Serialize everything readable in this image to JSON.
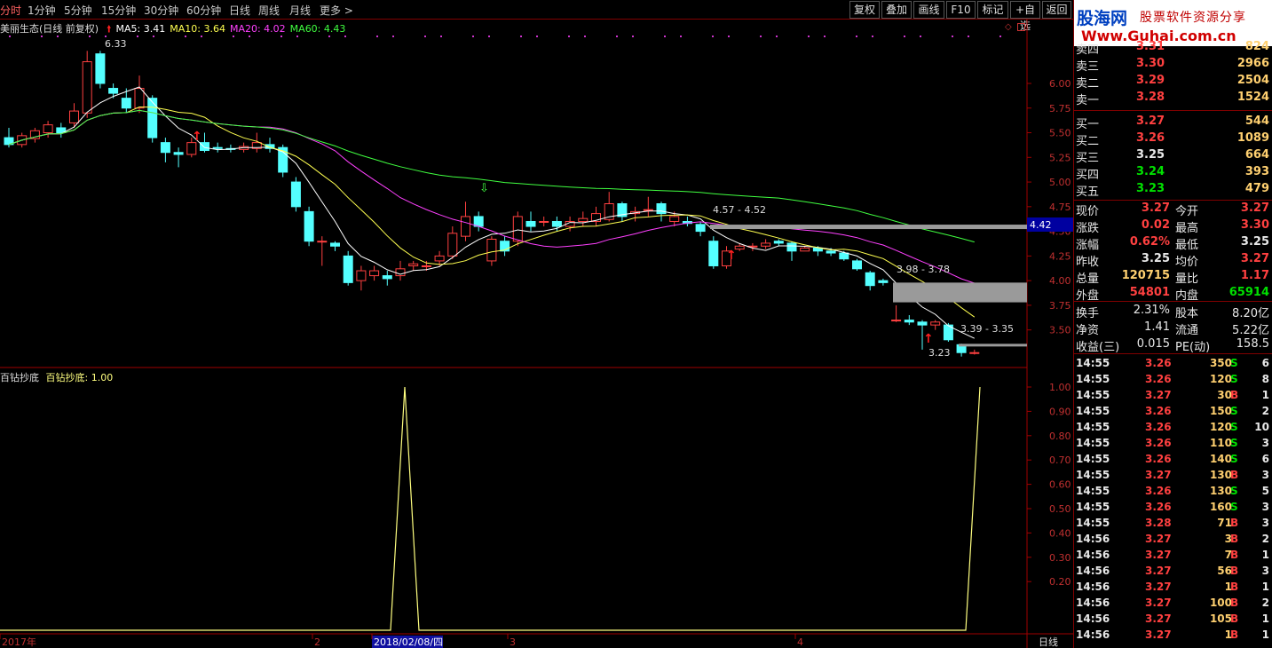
{
  "toolbar": {
    "timeframes": [
      "分时",
      "1分钟",
      "5分钟",
      "15分钟",
      "30分钟",
      "60分钟",
      "日线",
      "周线",
      "月线",
      "更多 >"
    ],
    "buttons": [
      "复权",
      "叠加",
      "画线",
      "F10",
      "标记",
      "+自选",
      "返回"
    ]
  },
  "main_chart": {
    "stock_title": "美丽生态(日线 前复权)",
    "ma_legend": [
      {
        "label": "MA5: 3.41",
        "color": "#ffffff"
      },
      {
        "label": "MA10: 3.64",
        "color": "#ffff50"
      },
      {
        "label": "MA20: 4.02",
        "color": "#ff40ff"
      },
      {
        "label": "MA60: 4.43",
        "color": "#40ff40"
      }
    ],
    "y_ticks": [
      "6.00",
      "5.75",
      "5.50",
      "5.25",
      "5.00",
      "4.75",
      "4.50",
      "4.25",
      "4.00",
      "3.75",
      "3.50"
    ],
    "price_tag": "4.42",
    "annotations": {
      "high": "6.33",
      "low": "3.23",
      "zone1": "4.57 - 4.52",
      "zone2": "3.98 - 3.78",
      "zone3": "3.39 - 3.35"
    }
  },
  "indicator": {
    "name": "百钻抄底",
    "label": "百钻抄底: 1.00",
    "y_ticks": [
      "1.00",
      "0.90",
      "0.80",
      "0.70",
      "0.60",
      "0.50",
      "0.40",
      "0.30",
      "0.20"
    ]
  },
  "x_axis": {
    "labels": [
      "2017年",
      "2",
      "2018/02/08/四",
      "3",
      "4"
    ],
    "period": "日线"
  },
  "chart_data": {
    "type": "candlestick",
    "title": "美丽生态(日线 前复权)",
    "ylim": [
      3.2,
      6.45
    ],
    "candles": [
      {
        "o": 5.45,
        "c": 5.38,
        "h": 5.55,
        "l": 5.35
      },
      {
        "o": 5.38,
        "c": 5.47,
        "h": 5.5,
        "l": 5.35
      },
      {
        "o": 5.44,
        "c": 5.52,
        "h": 5.55,
        "l": 5.4
      },
      {
        "o": 5.5,
        "c": 5.58,
        "h": 5.62,
        "l": 5.45
      },
      {
        "o": 5.55,
        "c": 5.5,
        "h": 5.6,
        "l": 5.45
      },
      {
        "o": 5.6,
        "c": 5.72,
        "h": 5.8,
        "l": 5.55
      },
      {
        "o": 5.7,
        "c": 6.22,
        "h": 6.33,
        "l": 5.65
      },
      {
        "o": 6.3,
        "c": 6.0,
        "h": 6.33,
        "l": 5.95
      },
      {
        "o": 5.95,
        "c": 5.9,
        "h": 6.0,
        "l": 5.85
      },
      {
        "o": 5.85,
        "c": 5.75,
        "h": 5.95,
        "l": 5.7
      },
      {
        "o": 5.75,
        "c": 5.95,
        "h": 6.08,
        "l": 5.7
      },
      {
        "o": 5.85,
        "c": 5.45,
        "h": 5.88,
        "l": 5.4
      },
      {
        "o": 5.4,
        "c": 5.3,
        "h": 5.45,
        "l": 5.2
      },
      {
        "o": 5.3,
        "c": 5.28,
        "h": 5.35,
        "l": 5.15
      },
      {
        "o": 5.28,
        "c": 5.4,
        "h": 5.45,
        "l": 5.25
      },
      {
        "o": 5.4,
        "c": 5.32,
        "h": 5.5,
        "l": 5.3
      },
      {
        "o": 5.35,
        "c": 5.34,
        "h": 5.4,
        "l": 5.3
      },
      {
        "o": 5.34,
        "c": 5.33,
        "h": 5.38,
        "l": 5.3
      },
      {
        "o": 5.33,
        "c": 5.36,
        "h": 5.4,
        "l": 5.3
      },
      {
        "o": 5.34,
        "c": 5.4,
        "h": 5.5,
        "l": 5.3
      },
      {
        "o": 5.38,
        "c": 5.34,
        "h": 5.45,
        "l": 5.3
      },
      {
        "o": 5.35,
        "c": 5.1,
        "h": 5.38,
        "l": 5.05
      },
      {
        "o": 5.0,
        "c": 4.75,
        "h": 5.05,
        "l": 4.7
      },
      {
        "o": 4.7,
        "c": 4.4,
        "h": 4.75,
        "l": 4.35
      },
      {
        "o": 4.4,
        "c": 4.4,
        "h": 4.45,
        "l": 4.15
      },
      {
        "o": 4.38,
        "c": 4.35,
        "h": 4.4,
        "l": 4.3
      },
      {
        "o": 4.25,
        "c": 3.98,
        "h": 4.3,
        "l": 3.95
      },
      {
        "o": 4.0,
        "c": 4.1,
        "h": 4.15,
        "l": 3.9
      },
      {
        "o": 4.05,
        "c": 4.1,
        "h": 4.15,
        "l": 4.0
      },
      {
        "o": 4.05,
        "c": 4.02,
        "h": 4.1,
        "l": 3.95
      },
      {
        "o": 4.05,
        "c": 4.12,
        "h": 4.2,
        "l": 4.0
      },
      {
        "o": 4.15,
        "c": 4.17,
        "h": 4.2,
        "l": 4.1
      },
      {
        "o": 4.15,
        "c": 4.15,
        "h": 4.2,
        "l": 4.1
      },
      {
        "o": 4.2,
        "c": 4.25,
        "h": 4.3,
        "l": 4.15
      },
      {
        "o": 4.25,
        "c": 4.48,
        "h": 4.55,
        "l": 4.22
      },
      {
        "o": 4.45,
        "c": 4.65,
        "h": 4.8,
        "l": 4.4
      },
      {
        "o": 4.65,
        "c": 4.55,
        "h": 4.7,
        "l": 4.5
      },
      {
        "o": 4.2,
        "c": 4.42,
        "h": 4.45,
        "l": 4.15
      },
      {
        "o": 4.4,
        "c": 4.3,
        "h": 4.45,
        "l": 4.25
      },
      {
        "o": 4.4,
        "c": 4.65,
        "h": 4.7,
        "l": 4.35
      },
      {
        "o": 4.6,
        "c": 4.55,
        "h": 4.7,
        "l": 4.5
      },
      {
        "o": 4.6,
        "c": 4.6,
        "h": 4.65,
        "l": 4.55
      },
      {
        "o": 4.6,
        "c": 4.55,
        "h": 4.65,
        "l": 4.5
      },
      {
        "o": 4.55,
        "c": 4.6,
        "h": 4.65,
        "l": 4.5
      },
      {
        "o": 4.6,
        "c": 4.63,
        "h": 4.7,
        "l": 4.55
      },
      {
        "o": 4.6,
        "c": 4.68,
        "h": 4.75,
        "l": 4.55
      },
      {
        "o": 4.62,
        "c": 4.78,
        "h": 4.9,
        "l": 4.6
      },
      {
        "o": 4.78,
        "c": 4.65,
        "h": 4.8,
        "l": 4.6
      },
      {
        "o": 4.68,
        "c": 4.7,
        "h": 4.75,
        "l": 4.6
      },
      {
        "o": 4.72,
        "c": 4.72,
        "h": 4.85,
        "l": 4.65
      },
      {
        "o": 4.78,
        "c": 4.68,
        "h": 4.8,
        "l": 4.6
      },
      {
        "o": 4.6,
        "c": 4.65,
        "h": 4.7,
        "l": 4.55
      },
      {
        "o": 4.6,
        "c": 4.58,
        "h": 4.65,
        "l": 4.55
      },
      {
        "o": 4.57,
        "c": 4.5,
        "h": 4.6,
        "l": 4.45
      },
      {
        "o": 4.4,
        "c": 4.15,
        "h": 4.45,
        "l": 4.12
      },
      {
        "o": 4.15,
        "c": 4.3,
        "h": 4.35,
        "l": 4.12
      },
      {
        "o": 4.32,
        "c": 4.35,
        "h": 4.38,
        "l": 4.3
      },
      {
        "o": 4.35,
        "c": 4.35,
        "h": 4.38,
        "l": 4.3
      },
      {
        "o": 4.35,
        "c": 4.38,
        "h": 4.42,
        "l": 4.32
      },
      {
        "o": 4.4,
        "c": 4.38,
        "h": 4.42,
        "l": 4.35
      },
      {
        "o": 4.38,
        "c": 4.3,
        "h": 4.4,
        "l": 4.2
      },
      {
        "o": 4.3,
        "c": 4.33,
        "h": 4.35,
        "l": 4.3
      },
      {
        "o": 4.33,
        "c": 4.3,
        "h": 4.35,
        "l": 4.25
      },
      {
        "o": 4.3,
        "c": 4.28,
        "h": 4.33,
        "l": 4.25
      },
      {
        "o": 4.28,
        "c": 4.22,
        "h": 4.3,
        "l": 4.2
      },
      {
        "o": 4.2,
        "c": 4.12,
        "h": 4.22,
        "l": 4.1
      },
      {
        "o": 4.08,
        "c": 3.95,
        "h": 4.1,
        "l": 3.9
      },
      {
        "o": 4.0,
        "c": 3.98,
        "h": 4.02,
        "l": 3.95
      },
      {
        "o": 3.6,
        "c": 3.6,
        "h": 3.75,
        "l": 3.58
      },
      {
        "o": 3.6,
        "c": 3.58,
        "h": 3.65,
        "l": 3.55
      },
      {
        "o": 3.58,
        "c": 3.55,
        "h": 3.6,
        "l": 3.3
      },
      {
        "o": 3.55,
        "c": 3.58,
        "h": 3.6,
        "l": 3.5
      },
      {
        "o": 3.55,
        "c": 3.4,
        "h": 3.57,
        "l": 3.38
      },
      {
        "o": 3.35,
        "c": 3.27,
        "h": 3.36,
        "l": 3.23
      },
      {
        "o": 3.27,
        "c": 3.27,
        "h": 3.3,
        "l": 3.25
      }
    ]
  },
  "order_book": {
    "asks": [
      {
        "label": "卖四",
        "price": "3.31",
        "vol": "824"
      },
      {
        "label": "卖三",
        "price": "3.30",
        "vol": "2966"
      },
      {
        "label": "卖二",
        "price": "3.29",
        "vol": "2504"
      },
      {
        "label": "卖一",
        "price": "3.28",
        "vol": "1524"
      }
    ],
    "bids": [
      {
        "label": "买一",
        "price": "3.27",
        "vol": "544"
      },
      {
        "label": "买二",
        "price": "3.26",
        "vol": "1089"
      },
      {
        "label": "买三",
        "price": "3.25",
        "vol": "664"
      },
      {
        "label": "买四",
        "price": "3.24",
        "vol": "393"
      },
      {
        "label": "买五",
        "price": "3.23",
        "vol": "479"
      }
    ]
  },
  "quote": [
    {
      "l1": "现价",
      "v1": "3.27",
      "l2": "今开",
      "v2": "3.27"
    },
    {
      "l1": "涨跌",
      "v1": "0.02",
      "l2": "最高",
      "v2": "3.30"
    },
    {
      "l1": "涨幅",
      "v1": "0.62%",
      "l2": "最低",
      "v2": "3.25"
    },
    {
      "l1": "昨收",
      "v1": "3.25",
      "l2": "均价",
      "v2": "3.27"
    },
    {
      "l1": "总量",
      "v1": "120715",
      "l2": "量比",
      "v2": "1.17"
    },
    {
      "l1": "外盘",
      "v1": "54801",
      "l2": "内盘",
      "v2": "65914"
    }
  ],
  "finance": [
    {
      "l1": "换手",
      "v1": "2.31%",
      "l2": "股本",
      "v2": "8.20亿"
    },
    {
      "l1": "净资",
      "v1": "1.41",
      "l2": "流通",
      "v2": "5.22亿"
    },
    {
      "l1": "收益(三)",
      "v1": "0.015",
      "l2": "PE(动)",
      "v2": "158.5"
    }
  ],
  "ticks": [
    {
      "t": "14:55",
      "p": "3.26",
      "v": "350",
      "s": "S",
      "n": "6"
    },
    {
      "t": "14:55",
      "p": "3.26",
      "v": "120",
      "s": "S",
      "n": "8"
    },
    {
      "t": "14:55",
      "p": "3.27",
      "v": "30",
      "s": "B",
      "n": "1"
    },
    {
      "t": "14:55",
      "p": "3.26",
      "v": "150",
      "s": "S",
      "n": "2"
    },
    {
      "t": "14:55",
      "p": "3.26",
      "v": "120",
      "s": "S",
      "n": "10"
    },
    {
      "t": "14:55",
      "p": "3.26",
      "v": "110",
      "s": "S",
      "n": "3"
    },
    {
      "t": "14:55",
      "p": "3.26",
      "v": "140",
      "s": "S",
      "n": "6"
    },
    {
      "t": "14:55",
      "p": "3.27",
      "v": "130",
      "s": "B",
      "n": "3"
    },
    {
      "t": "14:55",
      "p": "3.26",
      "v": "130",
      "s": "S",
      "n": "5"
    },
    {
      "t": "14:55",
      "p": "3.26",
      "v": "160",
      "s": "S",
      "n": "3"
    },
    {
      "t": "14:55",
      "p": "3.28",
      "v": "71",
      "s": "B",
      "n": "3"
    },
    {
      "t": "14:56",
      "p": "3.27",
      "v": "3",
      "s": "B",
      "n": "2"
    },
    {
      "t": "14:56",
      "p": "3.27",
      "v": "7",
      "s": "B",
      "n": "1"
    },
    {
      "t": "14:56",
      "p": "3.27",
      "v": "56",
      "s": "B",
      "n": "3"
    },
    {
      "t": "14:56",
      "p": "3.27",
      "v": "1",
      "s": "B",
      "n": "1"
    },
    {
      "t": "14:56",
      "p": "3.27",
      "v": "100",
      "s": "B",
      "n": "2"
    },
    {
      "t": "14:56",
      "p": "3.27",
      "v": "105",
      "s": "B",
      "n": "1"
    },
    {
      "t": "14:56",
      "p": "3.27",
      "v": "1",
      "s": "B",
      "n": "1"
    }
  ],
  "brand": {
    "name": "股海网",
    "slogan": "股票软件资源分享",
    "url": "Www.Guhai.com.cn"
  }
}
